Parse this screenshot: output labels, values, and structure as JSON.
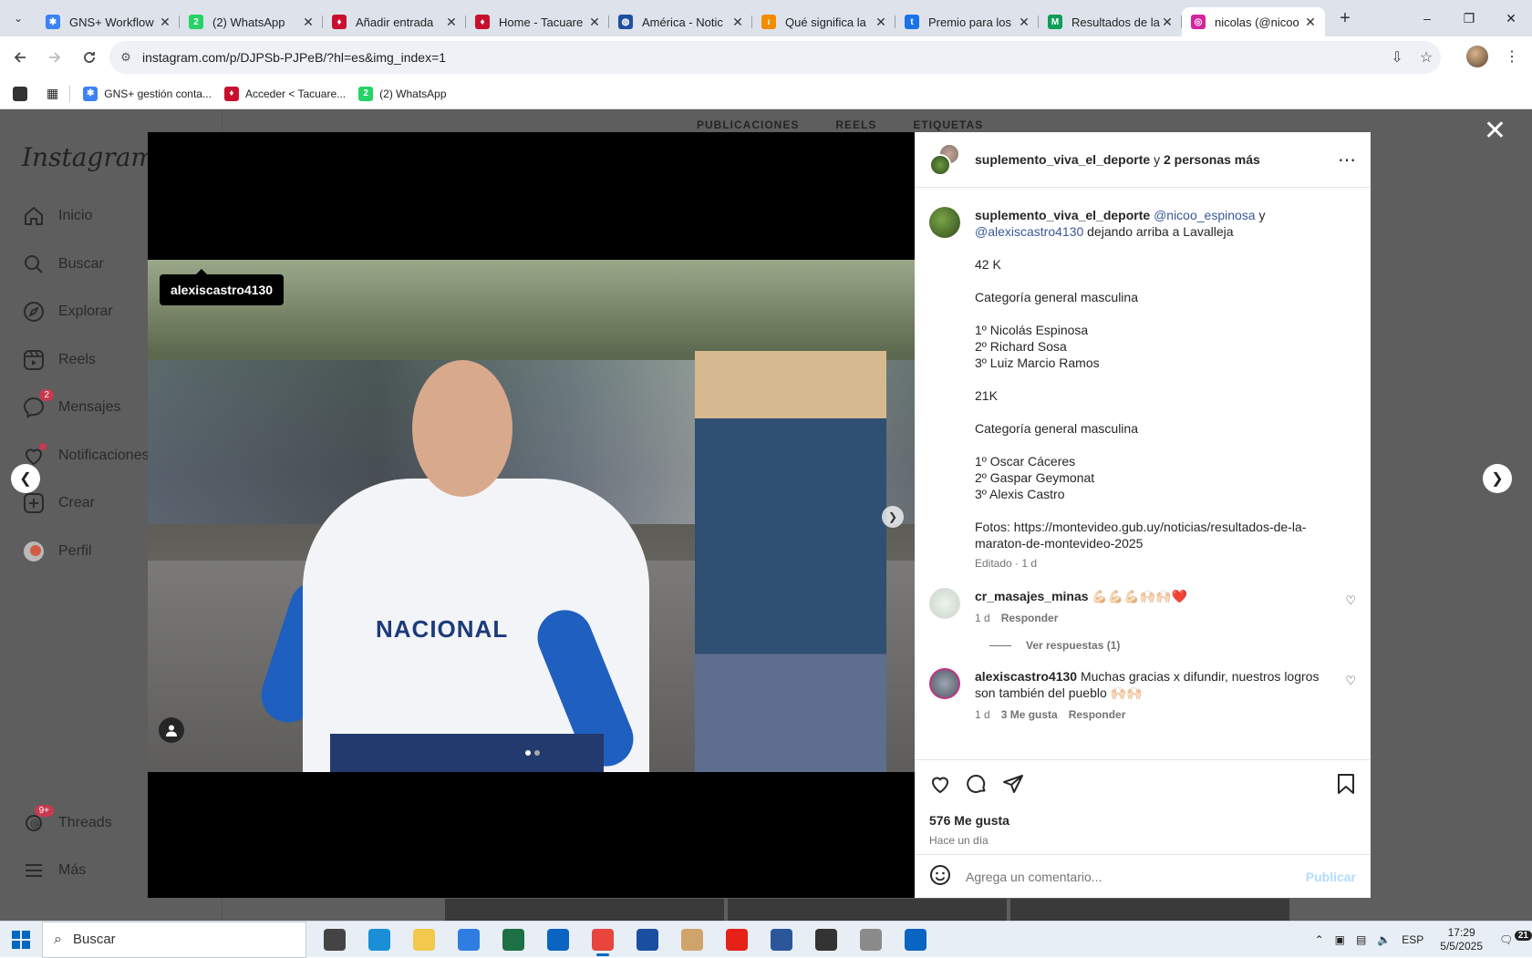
{
  "browser": {
    "tabs": [
      {
        "title": "GNS+ Workflow",
        "color": "#3b82f6",
        "glyph": "✱"
      },
      {
        "title": "(2) WhatsApp",
        "color": "#25d366",
        "glyph": "2"
      },
      {
        "title": "Añadir entrada",
        "color": "#c8102e",
        "glyph": "♦"
      },
      {
        "title": "Home - Tacuare",
        "color": "#c8102e",
        "glyph": "♦"
      },
      {
        "title": "América - Notic",
        "color": "#1e4fa1",
        "glyph": "◍"
      },
      {
        "title": "Qué significa la",
        "color": "#f28c00",
        "glyph": "ı"
      },
      {
        "title": "Premio para los",
        "color": "#1a73e8",
        "glyph": "t"
      },
      {
        "title": "Resultados de la",
        "color": "#0f9d58",
        "glyph": "M"
      },
      {
        "title": "nicolas (@nicoo",
        "color": "#d6249f",
        "glyph": "◎"
      }
    ],
    "new_tab": "+",
    "window_controls": [
      "–",
      "❐",
      "✕"
    ],
    "url": "instagram.com/p/DJPSb-PJPeB/?hl=es&img_index=1",
    "bookmarks": [
      {
        "label": "GNS+ gestión conta...",
        "color": "#3b82f6",
        "glyph": "✱"
      },
      {
        "label": "Acceder < Tacuare...",
        "color": "#c8102e",
        "glyph": "♦"
      },
      {
        "label": "(2) WhatsApp",
        "color": "#25d366",
        "glyph": "2"
      }
    ]
  },
  "instagram": {
    "logo": "Instagram",
    "nav": [
      {
        "label": "Inicio",
        "icon": "home-icon"
      },
      {
        "label": "Buscar",
        "icon": "search-icon"
      },
      {
        "label": "Explorar",
        "icon": "compass-icon"
      },
      {
        "label": "Reels",
        "icon": "reels-icon"
      },
      {
        "label": "Mensajes",
        "icon": "messenger-icon",
        "badge": "2"
      },
      {
        "label": "Notificaciones",
        "icon": "heart-icon",
        "dot": true
      },
      {
        "label": "Crear",
        "icon": "plus-icon"
      },
      {
        "label": "Perfil",
        "icon": "avatar"
      }
    ],
    "threads": {
      "label": "Threads",
      "badge": "9+"
    },
    "more": "Más",
    "profile_tabs": [
      "PUBLICACIONES",
      "REELS",
      "ETIQUETAS"
    ]
  },
  "post": {
    "tag": "alexiscastro4130",
    "jersey_text": "NACIONAL",
    "carousel": {
      "current": 1,
      "total": 2
    },
    "header": {
      "author": "suplemento_viva_el_deporte",
      "connector": " y ",
      "others": "2 personas más"
    },
    "caption": {
      "author": "suplemento_viva_el_deporte",
      "mention1": "@nicoo_espinosa",
      "and": " y ",
      "mention2": "@alexiscastro4130",
      "text1": " dejando arriba a Lavalleja",
      "lines": [
        "42 K",
        "",
        "Categoría general masculina",
        "",
        "1º Nicolás Espinosa",
        "2º Richard Sosa",
        "3º Luiz Marcio Ramos",
        "",
        "21K",
        "",
        "Categoría general masculina",
        "",
        "1º Oscar Cáceres",
        "2º Gaspar Geymonat",
        "3º Alexis Castro",
        "",
        "Fotos: https://montevideo.gub.uy/noticias/resultados-de-la-maraton-de-montevideo-2025"
      ],
      "meta": "Editado · 1 d"
    },
    "comments": [
      {
        "user": "cr_masajes_minas",
        "text": " 💪🏻💪🏻💪🏻🙌🏻🙌🏻❤️",
        "time": "1 d",
        "likes": "",
        "reply": "Responder",
        "view_replies": "Ver respuestas (1)"
      },
      {
        "user": "alexiscastro4130",
        "text": " Muchas gracias x difundir, nuestros logros son también del pueblo 🙌🏻🙌🏻",
        "time": "1 d",
        "likes": "3 Me gusta",
        "reply": "Responder",
        "view_replies": ""
      }
    ],
    "likes": "576 Me gusta",
    "ago": "Hace un día",
    "comment_placeholder": "Agrega un comentario...",
    "publish": "Publicar"
  },
  "taskbar": {
    "search": "Buscar",
    "apps": [
      {
        "name": "task-view",
        "color": "#444"
      },
      {
        "name": "edge",
        "color": "#1a8fd8"
      },
      {
        "name": "file-explorer",
        "color": "#f2c94c"
      },
      {
        "name": "store",
        "color": "#2f7de1"
      },
      {
        "name": "excel",
        "color": "#1d7044"
      },
      {
        "name": "outlook",
        "color": "#0a64c2"
      },
      {
        "name": "chrome",
        "color": "#e8453c"
      },
      {
        "name": "app-blue",
        "color": "#1a4fa0"
      },
      {
        "name": "paint",
        "color": "#cfa46a"
      },
      {
        "name": "youtube",
        "color": "#e62117"
      },
      {
        "name": "word",
        "color": "#2b579a"
      },
      {
        "name": "terminal",
        "color": "#333"
      },
      {
        "name": "settings",
        "color": "#8a8a8a"
      },
      {
        "name": "outlook-new",
        "color": "#0a64c2"
      }
    ],
    "lang": "ESP",
    "time": "17:29",
    "date": "5/5/2025",
    "notifications": "21"
  }
}
